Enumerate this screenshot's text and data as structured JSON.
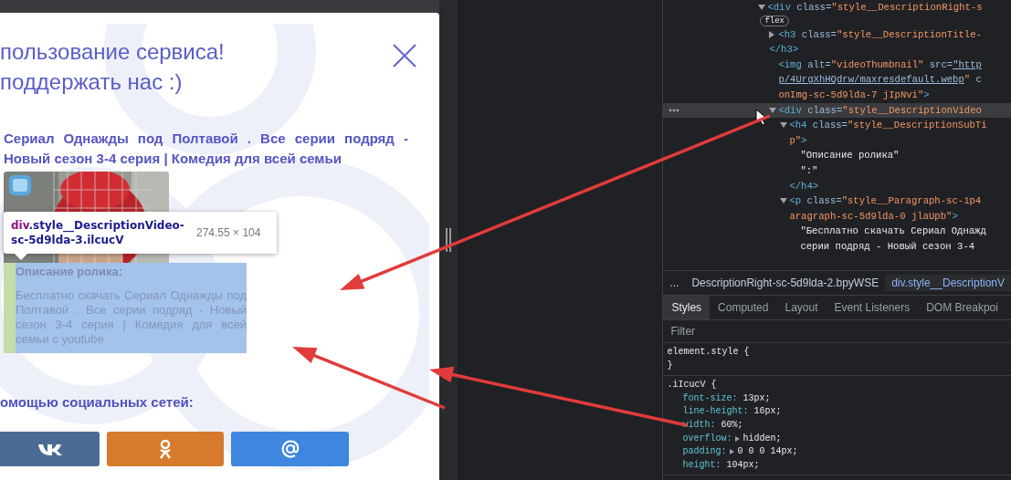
{
  "modal": {
    "title_lines": [
      "пользование сервиса!",
      "поддержать нас :)"
    ],
    "video": {
      "title": "Сериал Однажды под Полтавой . Все серии подряд - Новый сезон 3-4 серия | Комедия для всей семьи",
      "subtitle": "Описание ролика:",
      "description": "Бесплатно скачать Сериал Однажды под Полтавой . Все серии подряд - Новый сезон 3-4 серия | Комедия для всей семьи с youtube"
    },
    "share_heading": "омощью социальных сетей:",
    "share_buttons": [
      {
        "kind": "vk",
        "color": "#4b6b96"
      },
      {
        "kind": "ok",
        "color": "#d57b2b"
      },
      {
        "kind": "mail",
        "color": "#3e86e0"
      }
    ]
  },
  "inspect_tooltip": {
    "tag": "div",
    "selector": ".style__DescriptionVideo-sc-5d9lda-3.ilcucV",
    "size": "274.55 × 104"
  },
  "devtools": {
    "dom_tree": [
      {
        "selected": false,
        "expanded": true,
        "badge": "flex",
        "lines": [
          [
            {
              "kind": "tag",
              "text": "<div"
            },
            {
              "kind": "attr",
              "text": " class="
            },
            {
              "kind": "value",
              "text": "\"style__DescriptionRight-s"
            }
          ]
        ],
        "children": [
          {
            "selected": false,
            "expanded": false,
            "lines": [
              [
                {
                  "kind": "tag",
                  "text": "<h3"
                },
                {
                  "kind": "attr",
                  "text": " class="
                },
                {
                  "kind": "value",
                  "text": "\"style__DescriptionTitle-"
                }
              ]
            ],
            "closing": [
              {
                "kind": "tag",
                "text": "</h3>"
              }
            ]
          },
          {
            "selected": false,
            "lines": [
              [
                {
                  "kind": "tag",
                  "text": "<img"
                },
                {
                  "kind": "attr",
                  "text": " alt="
                },
                {
                  "kind": "value",
                  "text": "\"videoThumbnail\""
                },
                {
                  "kind": "attr",
                  "text": " src="
                },
                {
                  "kind": "link",
                  "text": "\"http"
                }
              ],
              [
                {
                  "kind": "link",
                  "text": "p/4UrgXhHQdrw/maxresdefault.webp"
                },
                {
                  "kind": "value",
                  "text": "\""
                },
                {
                  "kind": "attr",
                  "text": " c"
                }
              ],
              [
                {
                  "kind": "value",
                  "text": "onImg-sc-5d9lda-7 jIpNvi\""
                },
                {
                  "kind": "tag",
                  "text": ">"
                }
              ]
            ]
          },
          {
            "selected": true,
            "expanded": true,
            "lines": [
              [
                {
                  "kind": "tag",
                  "text": "<div"
                },
                {
                  "kind": "attr",
                  "text": " class="
                },
                {
                  "kind": "value",
                  "text": "\"style__DescriptionVideo"
                }
              ]
            ],
            "children": [
              {
                "selected": false,
                "expanded": true,
                "lines": [
                  [
                    {
                      "kind": "tag",
                      "text": "<h4"
                    },
                    {
                      "kind": "attr",
                      "text": " class="
                    },
                    {
                      "kind": "value",
                      "text": "\"style__DescriptionSubTi"
                    }
                  ],
                  [
                    {
                      "kind": "value",
                      "text": "p\""
                    },
                    {
                      "kind": "tag",
                      "text": ">"
                    }
                  ]
                ],
                "children": [
                  {
                    "selected": false,
                    "lines": [
                      [
                        {
                          "kind": "text",
                          "text": "\"Описание ролика\""
                        }
                      ]
                    ]
                  },
                  {
                    "selected": false,
                    "lines": [
                      [
                        {
                          "kind": "text",
                          "text": "\":\""
                        }
                      ]
                    ]
                  }
                ],
                "closing": [
                  {
                    "kind": "tag",
                    "text": "</h4>"
                  }
                ]
              },
              {
                "selected": false,
                "expanded": true,
                "lines": [
                  [
                    {
                      "kind": "tag",
                      "text": "<p"
                    },
                    {
                      "kind": "attr",
                      "text": " class="
                    },
                    {
                      "kind": "value",
                      "text": "\"style__Paragraph-sc-1p4"
                    }
                  ],
                  [
                    {
                      "kind": "value",
                      "text": "aragraph-sc-5d9lda-0 jlaUpb\""
                    },
                    {
                      "kind": "tag",
                      "text": ">"
                    }
                  ]
                ],
                "children": [
                  {
                    "selected": false,
                    "lines": [
                      [
                        {
                          "kind": "text",
                          "text": "\"Бесплатно скачать Сериал Однажд"
                        }
                      ],
                      [
                        {
                          "kind": "text",
                          "text": "серии подряд - Новый сезон 3-4"
                        }
                      ]
                    ]
                  }
                ]
              }
            ]
          }
        ]
      }
    ],
    "breadcrumb_overflow": "...",
    "breadcrumbs": [
      {
        "text": "DescriptionRight-sc-5d9lda-2.bpyWSE",
        "selected": false
      },
      {
        "text": "div.style__DescriptionV",
        "selected": true
      }
    ],
    "tabs": [
      {
        "label": "Styles",
        "selected": true
      },
      {
        "label": "Computed",
        "selected": false
      },
      {
        "label": "Layout",
        "selected": false
      },
      {
        "label": "Event Listeners",
        "selected": false
      },
      {
        "label": "DOM Breakpoi",
        "selected": false
      }
    ],
    "filter": {
      "placeholder": "Filter"
    },
    "style_rules": [
      {
        "selector": "element.style {",
        "close": "}"
      },
      {
        "selector": ".iIcucV {",
        "properties": [
          {
            "name": "font-size:",
            "value": "13px;"
          },
          {
            "name": "line-height:",
            "value": "16px;"
          },
          {
            "name": "width:",
            "value": "60%;"
          },
          {
            "name": "overflow:",
            "value": "hidden;",
            "expandable": true
          },
          {
            "name": "padding:",
            "value": "0 0 0 14px;",
            "expandable": true
          },
          {
            "name": "height:",
            "value": "104px;"
          }
        ]
      }
    ]
  }
}
